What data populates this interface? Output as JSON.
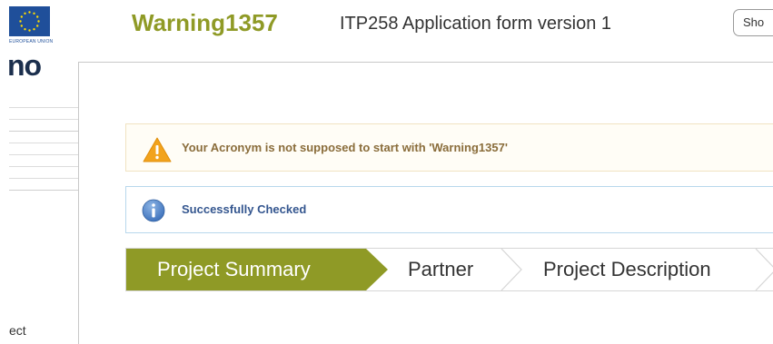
{
  "sidebar": {
    "eu_caption": "EUROPEAN UNION",
    "logo_fragment": "no",
    "nav_item_fragment": "ect"
  },
  "header": {
    "acronym": "Warning1357",
    "form_title": "ITP258 Application form version 1",
    "show_button_label": "Sho"
  },
  "messages": {
    "warning": "Your Acronym is not supposed to start with 'Warning1357'",
    "info": "Successfully Checked"
  },
  "steps": [
    {
      "label": "Project Summary",
      "active": true
    },
    {
      "label": "Partner",
      "active": false
    },
    {
      "label": "Project Description",
      "active": false
    }
  ],
  "colors": {
    "accent_olive": "#8f9a26",
    "warning_bg": "#fffdf6",
    "warning_text": "#8a6d3b",
    "info_text": "#34568f",
    "eu_blue": "#1f4f9a"
  }
}
